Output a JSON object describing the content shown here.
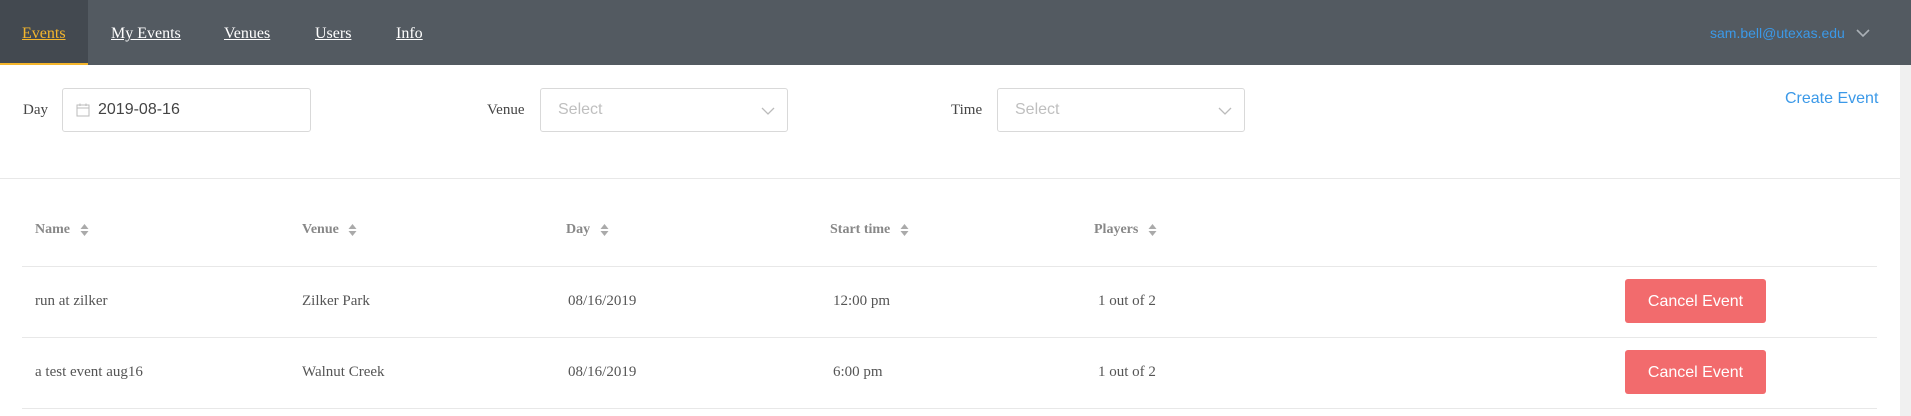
{
  "nav": {
    "tabs": [
      {
        "label": "Events",
        "active": true
      },
      {
        "label": "My Events",
        "active": false
      },
      {
        "label": "Venues",
        "active": false
      },
      {
        "label": "Users",
        "active": false
      },
      {
        "label": "Info",
        "active": false
      }
    ],
    "user_email": "sam.bell@utexas.edu",
    "user_menu_icon": "chevron-down-icon"
  },
  "filters": {
    "day_label": "Day",
    "day_value": "2019-08-16",
    "day_icon": "calendar-icon",
    "venue_label": "Venue",
    "venue_placeholder": "Select",
    "time_label": "Time",
    "time_placeholder": "Select"
  },
  "create_event_label": "Create Event",
  "table": {
    "columns": [
      "Name",
      "Venue",
      "Day",
      "Start time",
      "Players"
    ],
    "rows": [
      {
        "name": "run at zilker",
        "venue": "Zilker Park",
        "day": "08/16/2019",
        "start_time": "12:00 pm",
        "players": "1 out of 2",
        "action": "Cancel Event"
      },
      {
        "name": "a test event aug16",
        "venue": "Walnut Creek",
        "day": "08/16/2019",
        "start_time": "6:00 pm",
        "players": "1 out of 2",
        "action": "Cancel Event"
      }
    ]
  },
  "colors": {
    "nav_bg": "#535a61",
    "active_tab": "#f5b62c",
    "link_blue": "#3b99e8",
    "cancel_button": "#f26b6d"
  }
}
